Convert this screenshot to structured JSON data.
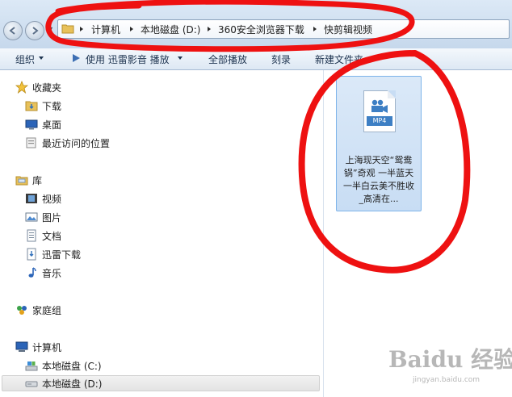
{
  "address_bar": {
    "crumbs": [
      "计算机",
      "本地磁盘 (D:)",
      "360安全浏览器下载",
      "快剪辑视频"
    ]
  },
  "toolbar": {
    "organize": "组织",
    "play_with": "使用 迅雷影音 播放",
    "play_all": "全部播放",
    "burn": "刻录",
    "new_folder": "新建文件夹"
  },
  "nav": {
    "favorites": "收藏夹",
    "downloads": "下载",
    "desktop": "桌面",
    "recent": "最近访问的位置",
    "libraries": "库",
    "videos": "视频",
    "pictures": "图片",
    "documents": "文档",
    "xunlei": "迅雷下载",
    "music": "音乐",
    "homegroup": "家庭组",
    "computer": "计算机",
    "drive_c": "本地磁盘 (C:)",
    "drive_d": "本地磁盘 (D:)"
  },
  "file": {
    "badge": "MP4",
    "name": "上海现天空“鸳鸯锅”奇观 一半蓝天一半白云美不胜收 _高清在..."
  },
  "watermark": {
    "logo": "Baidu 经验",
    "url": "jingyan.baidu.com"
  },
  "colors": {
    "annotation_red": "#ee1111",
    "selection_blue": "#cde0f5",
    "toolbar_text": "#1e3450"
  }
}
